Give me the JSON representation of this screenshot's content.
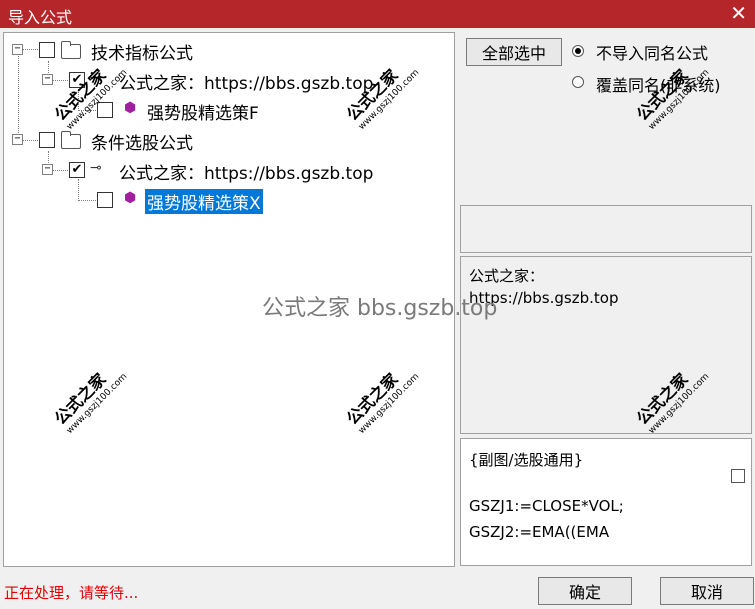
{
  "window": {
    "title": "导入公式",
    "close_glyph": "✕"
  },
  "tree": {
    "group1_label": "技术指标公式",
    "group1_child_label": "公式之家：https://bbs.gszb.top",
    "group1_leaf_label": "强势股精选策F",
    "group2_label": "条件选股公式",
    "group2_child_label": "公式之家：https://bbs.gszb.top",
    "group2_leaf_label": "强势股精选策X",
    "expander_glyph": "−",
    "check_glyph": "✔"
  },
  "options": {
    "select_all": "全部选中",
    "radio_skip": "不导入同名公式",
    "radio_overwrite": "覆盖同名(非系统)"
  },
  "info": {
    "line1": "公式之家：",
    "line2": "https://bbs.gszb.top"
  },
  "code": {
    "line1": "{副图/选股通用}",
    "line2": "GSZJ1:=CLOSE*VOL;",
    "line3": "GSZJ2:=EMA((EMA"
  },
  "buttons": {
    "ok": "确定",
    "cancel": "取消"
  },
  "status": "正在处理，请等待...",
  "overlay": "公式之家 bbs.gszb.top",
  "watermark": {
    "name": "公式之家",
    "url": "www.gszj100.com"
  },
  "icons": {
    "key": "⊸",
    "gem": "⬢"
  },
  "colors": {
    "titlebar": "#b5262b",
    "selection": "#0078d7",
    "status": "#e00000"
  }
}
